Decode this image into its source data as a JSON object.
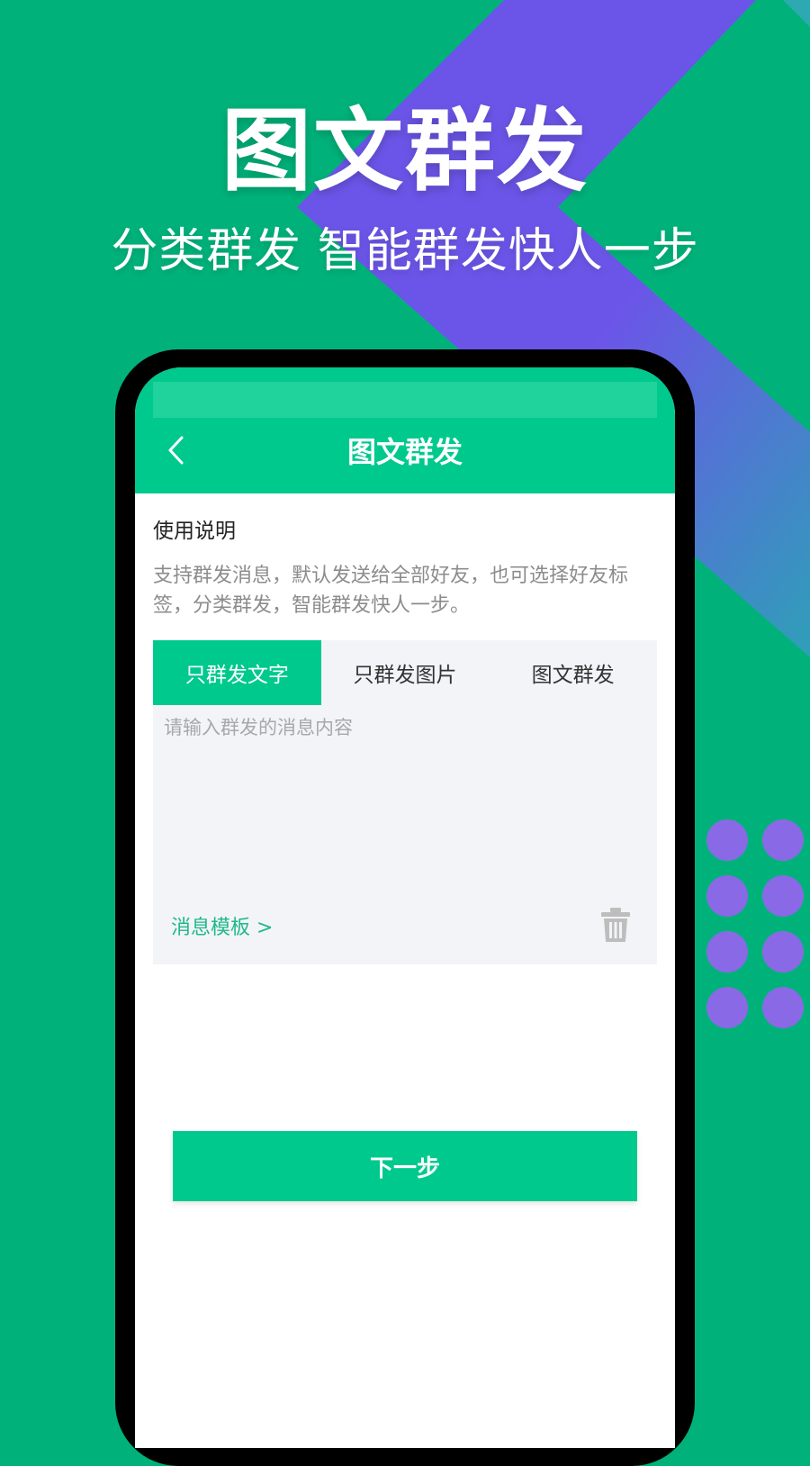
{
  "promo": {
    "title": "图文群发",
    "subtitle": "分类群发 智能群发快人一步"
  },
  "colors": {
    "background": "#00b27a",
    "diagonal_band": "#6b55e8",
    "band_gradient_end": "#2f9fb8",
    "dots": "#8a69e6",
    "app_primary": "#00c98e",
    "link": "#1fb88c",
    "card_background": "#f3f4f8"
  },
  "app": {
    "header": {
      "title": "图文群发",
      "back_icon": "chevron-left-icon"
    },
    "instructions": {
      "title": "使用说明",
      "description": "支持群发消息，默认发送给全部好友，也可选择好友标签，分类群发，智能群发快人一步。"
    },
    "tabs": [
      {
        "label": "只群发文字",
        "active": true
      },
      {
        "label": "只群发图片",
        "active": false
      },
      {
        "label": "图文群发",
        "active": false
      }
    ],
    "message": {
      "value": "",
      "placeholder": "请输入群发的消息内容"
    },
    "template_link": "消息模板 >",
    "delete_icon": "trash-icon",
    "next_button": "下一步"
  }
}
